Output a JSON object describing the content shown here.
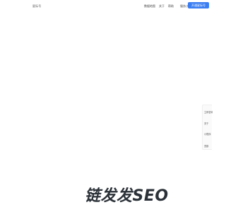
{
  "header": {
    "logo_text": "星际号",
    "nav": [
      "数据地图",
      "关于",
      "帮助",
      "服务/方案"
    ],
    "cta_label": "开通星际号"
  },
  "side_toolbar": {
    "items": [
      "立即咨询",
      "关于",
      "小程序",
      "顶部"
    ]
  },
  "watermark": {
    "text": "链发发SEO"
  }
}
